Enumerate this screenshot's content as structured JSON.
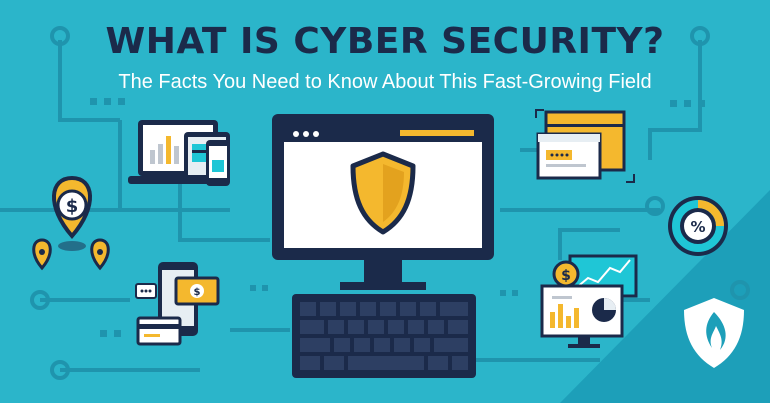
{
  "header": {
    "title": "WHAT IS CYBER SECURITY?",
    "subtitle": "The Facts You Need to Know About This Fast-Growing Field"
  },
  "illustration": {
    "badges": {
      "dollar_symbol": "$",
      "percent_symbol": "%"
    },
    "icons": [
      "shield-icon",
      "dollar-location-pin-icon",
      "percent-gauge-icon",
      "flame-shield-logo-icon",
      "computer-monitor",
      "keyboard",
      "laptop",
      "tablet",
      "smartphone",
      "credit-card",
      "browser-window"
    ]
  },
  "colors": {
    "background": "#2bb5ca",
    "navy": "#1b2a4a",
    "accent_yellow": "#f4b82e",
    "white": "#ffffff",
    "circuit": "#1f94ad"
  }
}
